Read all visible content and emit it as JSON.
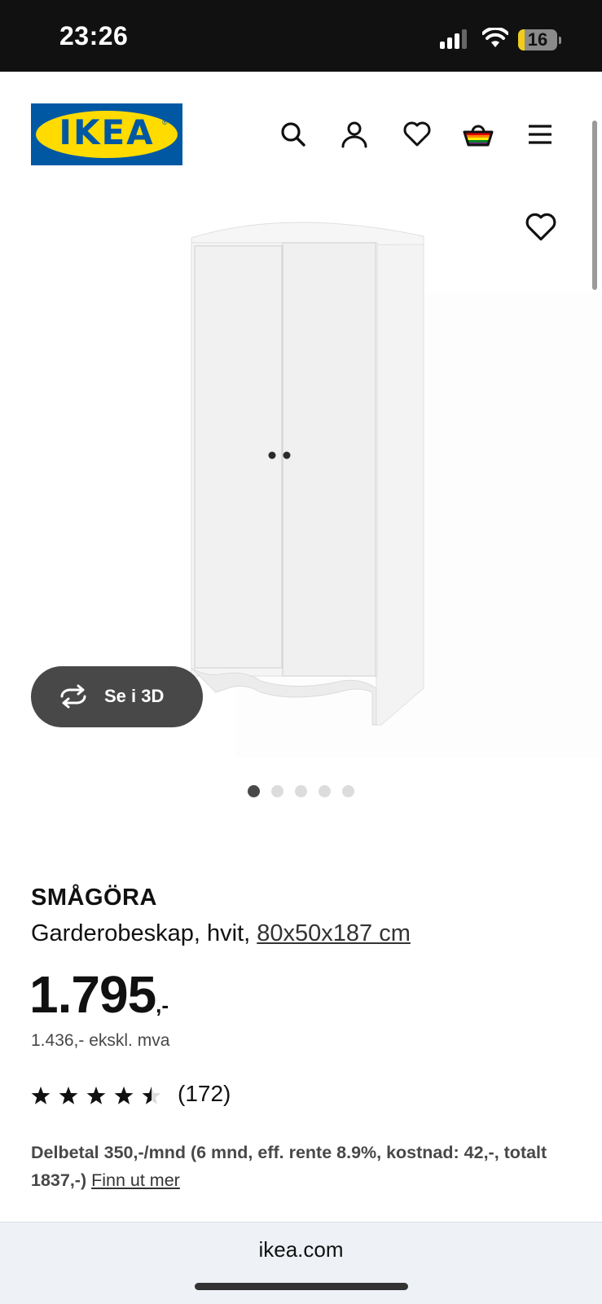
{
  "status_bar": {
    "time": "23:26",
    "battery": "16",
    "battery_level": 0.16,
    "signal_bars": 3,
    "signal_bars_total": 4
  },
  "header": {
    "logo_text": "IKEA",
    "logo_mark": "®",
    "icons": [
      "search-icon",
      "account-icon",
      "favorites-icon",
      "cart-icon",
      "menu-icon"
    ],
    "brand_colors": {
      "blue": "#0058a3",
      "yellow": "#ffdb00"
    }
  },
  "gallery": {
    "view_3d_label": "Se i 3D",
    "dots_total": 5,
    "active_index": 0
  },
  "product": {
    "name": "SMÅGÖRA",
    "description": "Garderobeskap, hvit,",
    "measurements": "80x50x187 cm",
    "price_main": "1.795",
    "price_suffix": ",-",
    "price_ex_vat": "1.436,- ekskl. mva",
    "rating_value": 4.5,
    "rating_count": "(172)",
    "installment_text": "Delbetal 350,-/mnd (6 mnd, eff. rente 8.9%, kostnad: 42,-, totalt 1837,-)",
    "installment_link": "Finn ut mer"
  },
  "browser": {
    "url": "ikea.com"
  }
}
